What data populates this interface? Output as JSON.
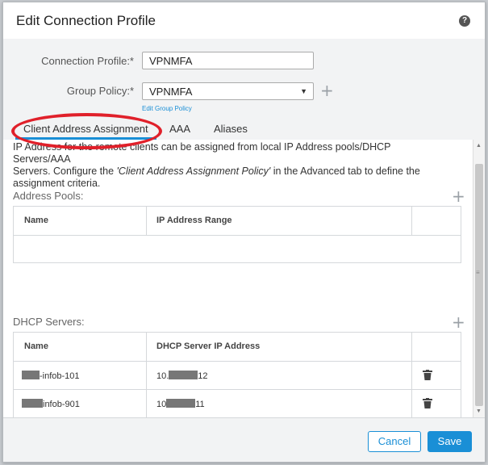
{
  "dialog": {
    "title": "Edit Connection Profile",
    "help_icon": "?"
  },
  "form": {
    "connection_profile_label": "Connection Profile:*",
    "connection_profile_value": "VPNMFA",
    "group_policy_label": "Group Policy:*",
    "group_policy_value": "VPNMFA",
    "edit_group_policy_link": "Edit Group Policy",
    "add_icon": "+"
  },
  "tabs": [
    {
      "label": "Client Address Assignment",
      "active": true
    },
    {
      "label": "AAA",
      "active": false
    },
    {
      "label": "Aliases",
      "active": false
    }
  ],
  "content": {
    "description_line1": "IP Address for the remote clients can be assigned from local IP Address pools/DHCP Servers/AAA",
    "description_line2_pre": "Servers. Configure the ",
    "description_line2_em": "'Client Address Assignment Policy'",
    "description_line2_post": " in the Advanced tab to define the",
    "description_line3": "assignment criteria.",
    "address_pools_label": "Address Pools:",
    "address_pools_columns": [
      "Name",
      "IP Address Range"
    ],
    "dhcp_servers_label": "DHCP Servers:",
    "dhcp_columns": [
      "Name",
      "DHCP Server IP Address"
    ],
    "dhcp_rows": [
      {
        "name": "-infob-101",
        "ip_prefix": "10.",
        "ip_suffix": "12"
      },
      {
        "name": "infob-901",
        "ip_prefix": "10",
        "ip_suffix": "11"
      }
    ]
  },
  "footer": {
    "cancel_label": "Cancel",
    "save_label": "Save"
  },
  "colors": {
    "accent": "#1a8fd6",
    "highlight_annotation": "#e0202a"
  },
  "icons": [
    "help-icon",
    "plus-icon",
    "chevron-down-icon",
    "trash-icon"
  ]
}
